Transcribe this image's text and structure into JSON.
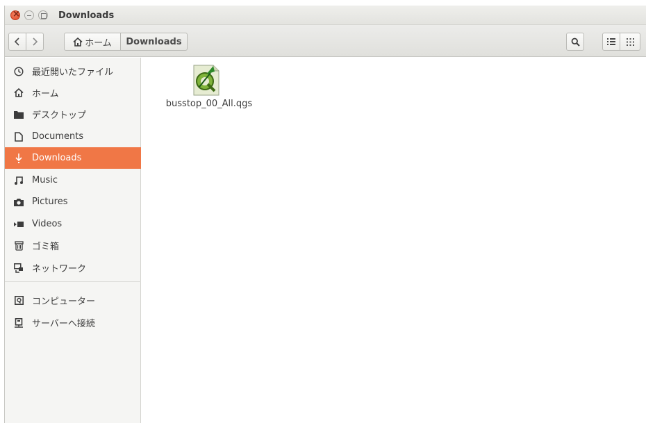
{
  "window": {
    "title": "Downloads"
  },
  "toolbar": {
    "back_icon": "chevron-left-icon",
    "forward_icon": "chevron-right-icon",
    "breadcrumb": [
      {
        "label": "ホーム",
        "icon": "home-icon"
      },
      {
        "label": "Downloads"
      }
    ],
    "search_icon": "search-icon",
    "list_view_icon": "list-view-icon",
    "grid_view_icon": "grid-view-icon"
  },
  "sidebar": {
    "items": [
      {
        "label": "最近開いたファイル",
        "icon": "recent-icon"
      },
      {
        "label": "ホーム",
        "icon": "home-icon"
      },
      {
        "label": "デスクトップ",
        "icon": "folder-icon"
      },
      {
        "label": "Documents",
        "icon": "document-icon"
      },
      {
        "label": "Downloads",
        "icon": "download-icon",
        "active": true
      },
      {
        "label": "Music",
        "icon": "music-icon"
      },
      {
        "label": "Pictures",
        "icon": "camera-icon"
      },
      {
        "label": "Videos",
        "icon": "video-icon"
      },
      {
        "label": "ゴミ箱",
        "icon": "trash-icon"
      },
      {
        "label": "ネットワーク",
        "icon": "network-icon"
      },
      {
        "label": "コンピューター",
        "icon": "computer-icon"
      },
      {
        "label": "サーバーへ接続",
        "icon": "server-icon"
      }
    ]
  },
  "content": {
    "files": [
      {
        "name": "busstop_00_All.qgs",
        "icon": "qgis-file-icon"
      }
    ]
  },
  "colors": {
    "accent": "#f07746",
    "sidebar_bg": "#f5f5f3",
    "toolbar_bg": "#e6e6e2"
  }
}
